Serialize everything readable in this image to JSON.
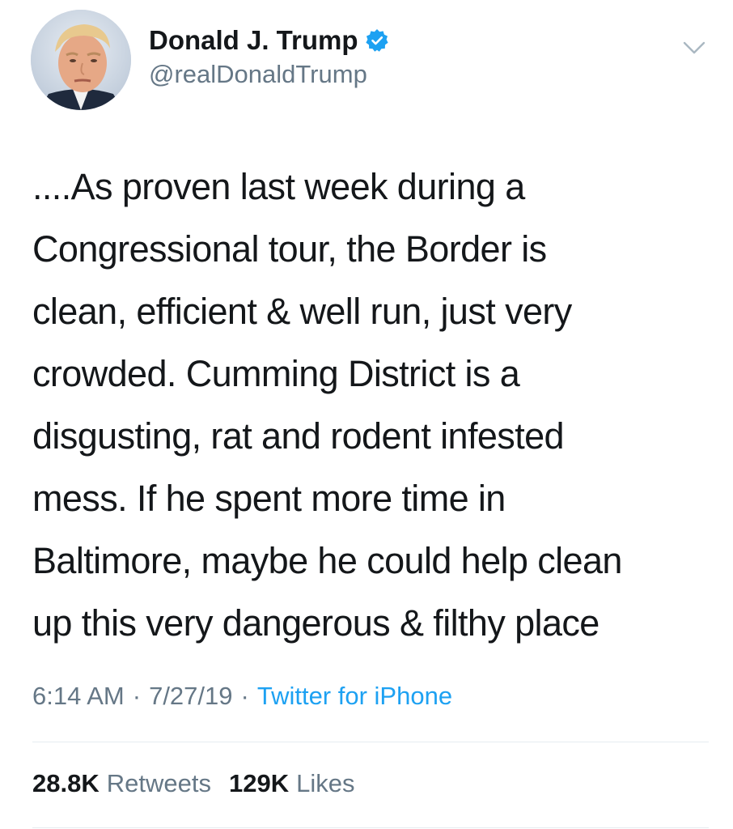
{
  "author": {
    "display_name": "Donald J. Trump",
    "handle": "@realDonaldTrump",
    "verified_icon": "verified-badge-icon",
    "avatar_icon": "profile-photo"
  },
  "menu": {
    "icon": "chevron-down-icon"
  },
  "tweet": {
    "lines": [
      "....As proven last week during a",
      "Congressional tour, the Border is",
      "clean, efficient & well run, just very",
      "crowded. Cumming District is a",
      "disgusting, rat and rodent infested",
      "mess. If he spent more time in",
      "Baltimore, maybe he could help clean",
      "up this very dangerous & filthy place"
    ]
  },
  "meta": {
    "time": "6:14 AM",
    "separator": "·",
    "date": "7/27/19",
    "source": "Twitter for iPhone"
  },
  "stats": {
    "retweets_count": "28.8K",
    "retweets_label": "Retweets",
    "likes_count": "129K",
    "likes_label": "Likes"
  },
  "colors": {
    "text": "#14171a",
    "secondary": "#657786",
    "accent": "#1da1f2",
    "divider": "#e6ecf0"
  }
}
